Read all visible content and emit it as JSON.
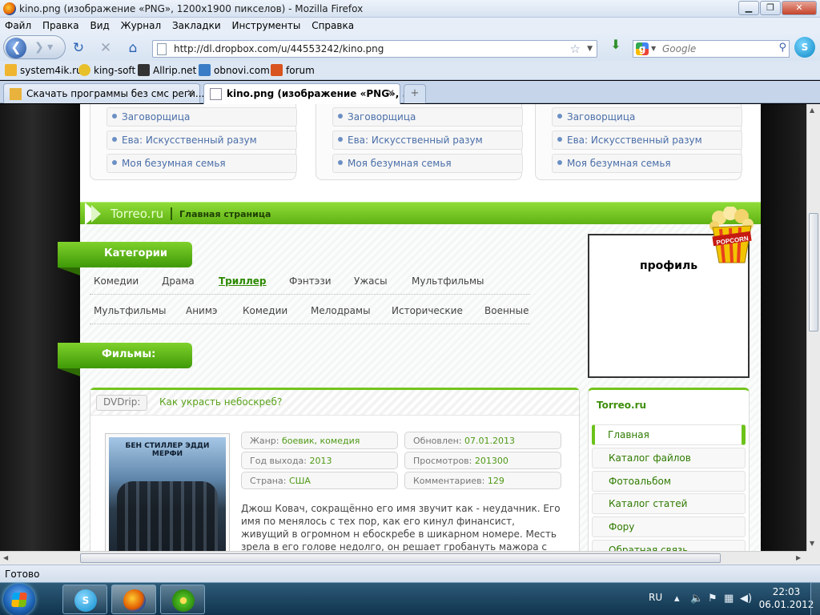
{
  "window": {
    "title": "kino.png (изображение «PNG», 1200x1900 пикселов) - Mozilla Firefox"
  },
  "menu": [
    "Файл",
    "Правка",
    "Вид",
    "Журнал",
    "Закладки",
    "Инструменты",
    "Справка"
  ],
  "nav": {
    "url": "http://dl.dropbox.com/u/44553242/kino.png",
    "search_placeholder": "Google"
  },
  "bookmarks": [
    "system4ik.ru",
    "king-soft",
    "Allrip.net",
    "obnovi.com",
    "forum"
  ],
  "tabs": [
    {
      "label": "Скачать программы без смс реги...",
      "active": false
    },
    {
      "label": "kino.png (изображение «PNG», ...",
      "active": true
    }
  ],
  "site": {
    "top_lists": [
      [
        "Заговорщица",
        "Ева: Искусственный разум",
        "Моя безумная семья"
      ],
      [
        "Заговорщица",
        "Ева: Искусственный разум",
        "Моя безумная семья"
      ],
      [
        "Заговорщица",
        "Ева: Искусственный разум",
        "Моя безумная семья"
      ]
    ],
    "logo": "Torreo.ru",
    "home_link": "Главная страница",
    "categories_title": "Категории",
    "categories_row1": [
      "Комедии",
      "Драма",
      "Триллер",
      "Фэнтэзи",
      "Ужасы",
      "Мультфильмы"
    ],
    "categories_row2": [
      "Мультфильмы",
      "Анимэ",
      "Комедии",
      "Мелодрамы",
      "Исторические",
      "Военные"
    ],
    "active_category": "Триллер",
    "films_title": "Фильмы:",
    "profile_title": "профиль",
    "popcorn_label": "POPCORN",
    "film": {
      "badge": "DVDrip:",
      "title": "Как украсть небоскреб?",
      "poster_names": "БЕН СТИЛЛЕР  ЭДДИ МЕРФИ",
      "genre_label": "Жанр:",
      "genre": "боевик, комедия",
      "year_label": "Год выхода:",
      "year": "2013",
      "country_label": "Страна:",
      "country": "США",
      "updated_label": "Обновлен:",
      "updated": "07.01.2013",
      "views_label": "Просмотров:",
      "views": "201300",
      "comments_label": "Комментариев:",
      "comments": "129",
      "description": "Джош Ковач, сокращённо его имя звучит как - неудачник. Его имя по менялось с тех пор, как его кинул финансист, живущий в огромном н ебоскребе в шикарном номере. Месть зрела в его голове недолго, он решает гробануть мажора с помощью своих друзей. Так как команда у"
    },
    "side_title": "Torreo.ru",
    "side_nav": [
      "Главная",
      "Каталог файлов",
      "Фотоальбом",
      "Каталог статей",
      "Фору",
      "Обратная связь"
    ]
  },
  "status": "Готово",
  "tray": {
    "lang": "RU",
    "time": "22:03",
    "date": "06.01.2012"
  },
  "colors": {
    "accent_green": "#74c41f",
    "link_blue": "#4a6ea8"
  }
}
